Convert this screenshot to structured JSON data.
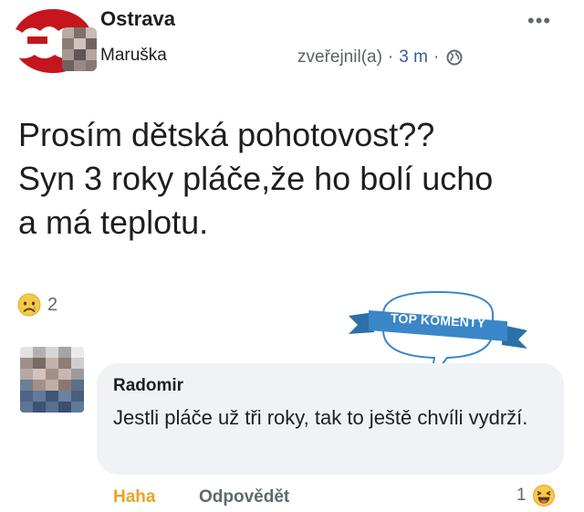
{
  "header": {
    "group_name": "Ostrava",
    "author_name": "Maruška",
    "posted_label": "zveřejnil(a)",
    "time": "3 m",
    "separator": "·",
    "privacy_icon": "globe-icon",
    "more_label": "•••"
  },
  "post": {
    "lines": [
      "Prosím dětská pohotovost??",
      "Syn 3 roky pláče,že ho bolí ucho",
      "a má teplotu."
    ]
  },
  "reactions": {
    "icon": "sad-reaction-icon",
    "count": "2"
  },
  "badge": {
    "label": "TOP KOMENTY",
    "color": "#3a86c8"
  },
  "comment": {
    "author": "Radomir",
    "text": "Jestli pláče už tři roky, tak to ještě chvíli vydrží.",
    "actions": {
      "haha": "Haha",
      "reply": "Odpovědět"
    },
    "reaction_count": "1",
    "reaction_icon": "laughing-reaction-icon"
  },
  "colors": {
    "text": "#1c1e21",
    "muted": "#606770",
    "link_blue": "#3b5998",
    "haha_orange": "#e8a427",
    "bubble": "#f0f2f5"
  }
}
